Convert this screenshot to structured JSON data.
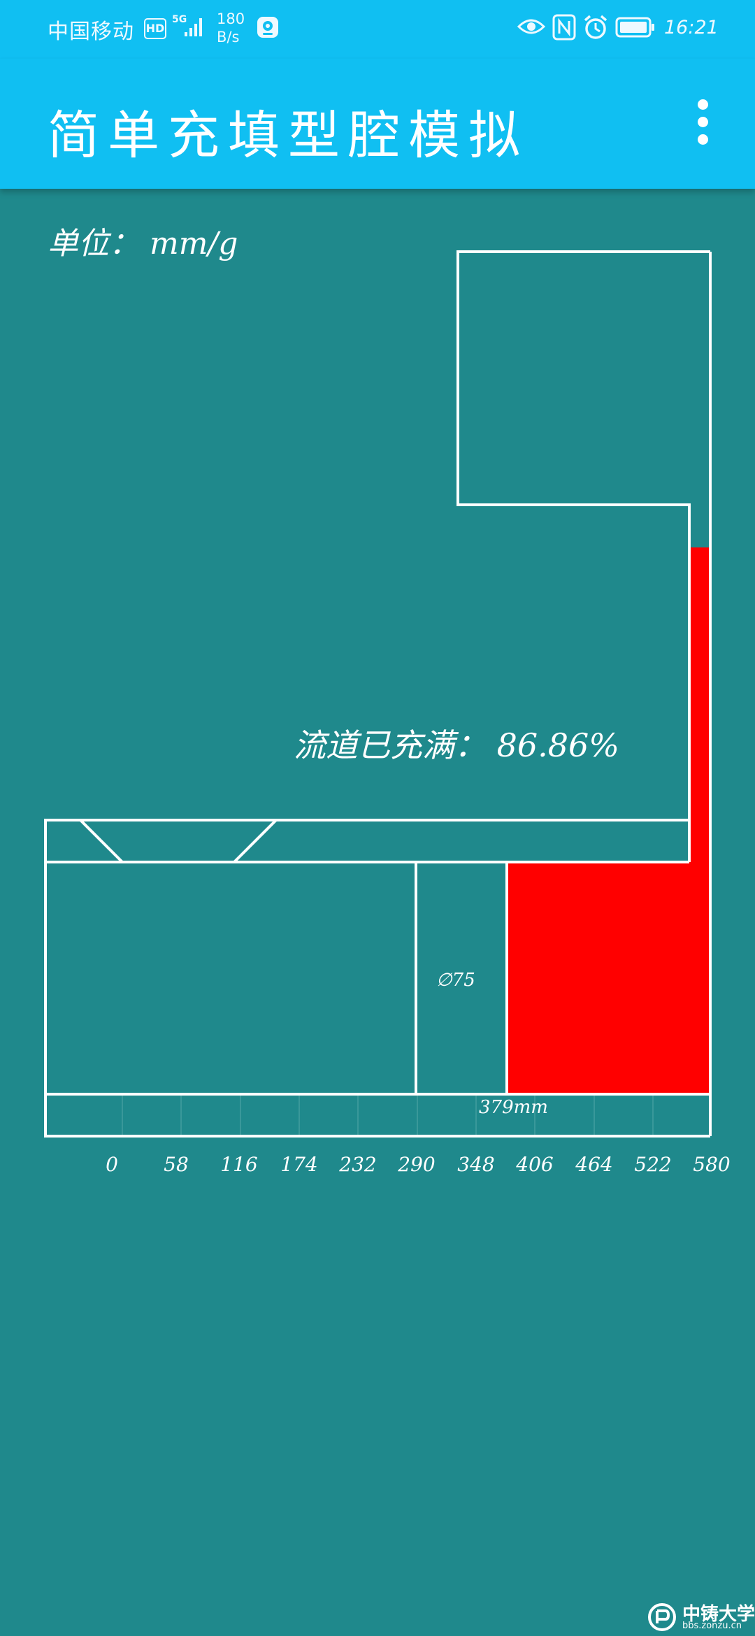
{
  "status_bar": {
    "carrier": "中国移动",
    "hd_badge": "HD",
    "network": "5G",
    "speed_value": "180",
    "speed_unit": "B/s",
    "time": "16:21",
    "icons": [
      "signal-icon",
      "app-notification-icon",
      "eye-icon",
      "nfc-icon",
      "alarm-icon",
      "battery-icon"
    ]
  },
  "app_bar": {
    "title": "简单充填型腔模拟",
    "overflow_icon": "more-vert-icon"
  },
  "simulation": {
    "unit_label": "单位： mm/g",
    "fill_status": "流道已充满： 86.86%",
    "diameter_label": "∅75",
    "length_label": "379mm",
    "ruler_ticks": [
      "0",
      "58",
      "116",
      "174",
      "232",
      "290",
      "348",
      "406",
      "464",
      "522",
      "580"
    ],
    "fill_color": "#ff0000",
    "background_color": "#1f898c",
    "line_color": "#ffffff"
  },
  "watermark": {
    "text": "中铸大学",
    "url": "bbs.zonzu.cn"
  }
}
